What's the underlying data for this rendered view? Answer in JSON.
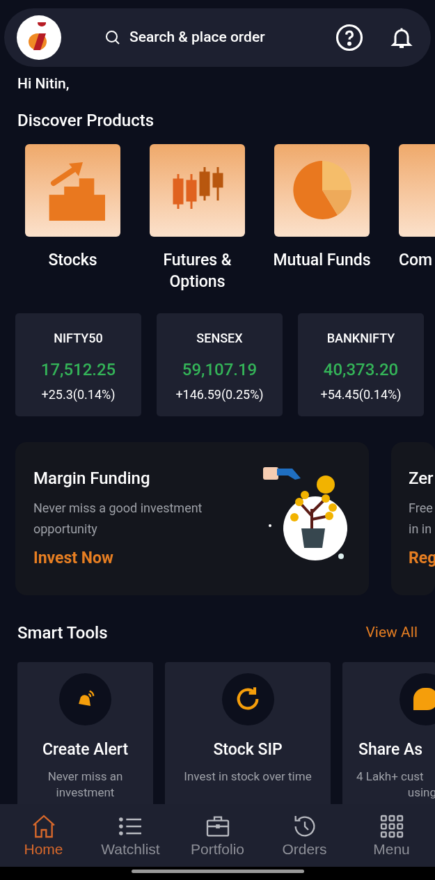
{
  "header": {
    "search_label": "Search & place order"
  },
  "greeting": "Hi Nitin,",
  "discover": {
    "title": "Discover Products",
    "products": [
      {
        "kind": "stocks",
        "label": "Stocks"
      },
      {
        "kind": "fno",
        "label": "Futures & Options"
      },
      {
        "kind": "mf",
        "label": "Mutual Funds"
      },
      {
        "kind": "commodity",
        "label": "Com"
      }
    ]
  },
  "indices": [
    {
      "name": "NIFTY50",
      "value": "17,512.25",
      "change": "+25.3(0.14%)"
    },
    {
      "name": "SENSEX",
      "value": "59,107.19",
      "change": "+146.59(0.25%)"
    },
    {
      "name": "BANKNIFTY",
      "value": "40,373.20",
      "change": "+54.45(0.14%)"
    }
  ],
  "banners": [
    {
      "title": "Margin Funding",
      "text": "Never miss a good investment opportunity",
      "action": "Invest Now"
    },
    {
      "title": "Zer",
      "text_lines": [
        "Free",
        "in in"
      ],
      "action": "Reg"
    }
  ],
  "smart_tools": {
    "title": "Smart Tools",
    "view_all": "View All",
    "tools": [
      {
        "kind": "alert",
        "title": "Create Alert",
        "text": "Never miss an investment"
      },
      {
        "kind": "sip",
        "title": "Stock SIP",
        "text": "Invest in stock over time"
      },
      {
        "kind": "share",
        "title": "Share As",
        "text_lines": [
          "4 Lakh+ cust",
          "using"
        ]
      }
    ]
  },
  "bottom_nav": [
    {
      "kind": "home",
      "label": "Home",
      "selected": true
    },
    {
      "kind": "watchlist",
      "label": "Watchlist",
      "selected": false
    },
    {
      "kind": "portfolio",
      "label": "Portfolio",
      "selected": false
    },
    {
      "kind": "orders",
      "label": "Orders",
      "selected": false
    },
    {
      "kind": "menu",
      "label": "Menu",
      "selected": false
    }
  ]
}
